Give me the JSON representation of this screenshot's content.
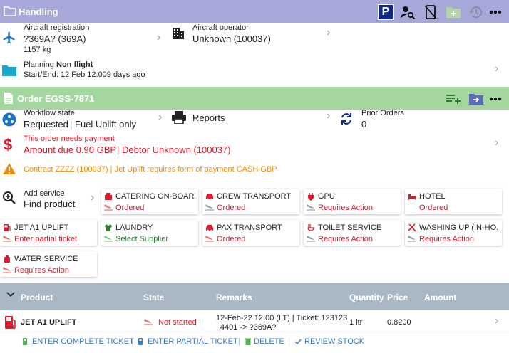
{
  "handling": {
    "title": "Handling",
    "aircraft_registration_label": "Aircraft registration",
    "aircraft_registration_value": "?369A? (369A)",
    "aircraft_weight": "1157 kg",
    "aircraft_operator_label": "Aircraft operator",
    "aircraft_operator_value": "Unknown (100037)",
    "planning_prefix": "Planning",
    "planning_value": "Non flight",
    "start_end": "Start/End: 12 Feb 12:009 days ago",
    "p_badge": "P"
  },
  "order": {
    "title": "Order EGSS-7871",
    "workflow_label": "Workflow state",
    "workflow_state": "Requested",
    "workflow_sep": "|",
    "workflow_type": "Fuel Uplift only",
    "reports_label": "Reports",
    "prior_orders_label": "Prior Orders",
    "prior_orders_value": "0",
    "payment_notice": "This order needs payment",
    "amount_due": "Amount due 0.90 GBP",
    "debtor_sep": "|",
    "debtor": "Debtor Unknown (100037)",
    "contract_warning": "Contract ZZZZ (100037) | Jet Uplift requires form of payment CASH GBP"
  },
  "add_service": {
    "label": "Add service",
    "action": "Find product"
  },
  "services": [
    {
      "name": "CATERING ON-BOARD",
      "status": "Ordered",
      "status_color": "#d81b2a",
      "icon": "catering-icon"
    },
    {
      "name": "CREW TRANSPORT",
      "status": "Ordered",
      "status_color": "#d81b2a",
      "icon": "car-icon"
    },
    {
      "name": "GPU",
      "status": "Requires Action",
      "status_color": "#d81b2a",
      "icon": "plug-icon"
    },
    {
      "name": "HOTEL",
      "status": "Ordered",
      "status_color": "#d81b2a",
      "icon": "bed-icon"
    },
    {
      "name": "JET A1 UPLIFT",
      "status": "Enter partial ticket",
      "status_color": "#d81b2a",
      "icon": "fuel-icon"
    },
    {
      "name": "LAUNDRY",
      "status": "Select Supplier",
      "status_color": "#2e7d32",
      "icon": "shirt-icon"
    },
    {
      "name": "PAX TRANSPORT",
      "status": "Ordered",
      "status_color": "#d81b2a",
      "icon": "car-icon"
    },
    {
      "name": "TOILET SERVICE",
      "status": "Requires Action",
      "status_color": "#d81b2a",
      "icon": "toilet-icon"
    },
    {
      "name": "WASHING UP (IN-HO...",
      "status": "Requires Action",
      "status_color": "#d81b2a",
      "icon": "utensils-icon"
    },
    {
      "name": "WATER SERVICE",
      "status": "Requires Action",
      "status_color": "#d81b2a",
      "icon": "water-icon"
    }
  ],
  "table": {
    "headers": {
      "product": "Product",
      "state": "State",
      "remarks": "Remarks",
      "quantity": "Quantity",
      "price": "Price",
      "amount": "Amount"
    },
    "rows": [
      {
        "product": "JET A1 UPLIFT",
        "state": "Not started",
        "remarks_line1": "12-Feb-22 12:00 (LT) | Ticket: 123123",
        "remarks_line2": "| 4401 -> ?369A?",
        "quantity": "1 ltr",
        "price": "0.8200",
        "amount": ""
      }
    ],
    "actions": {
      "complete": "ENTER COMPLETE TICKET",
      "partial": "ENTER PARTIAL TICKET",
      "delete": "DELETE",
      "review": "REVIEW STOCK"
    }
  },
  "colors": {
    "handling_header": "#a7a8da",
    "order_header": "#a6d6a0",
    "table_header": "#a9b8c4",
    "accent_blue": "#1a73c8",
    "alert_red": "#d81b2a",
    "warning_orange": "#f08c00",
    "link_blue": "#3a78c2"
  }
}
